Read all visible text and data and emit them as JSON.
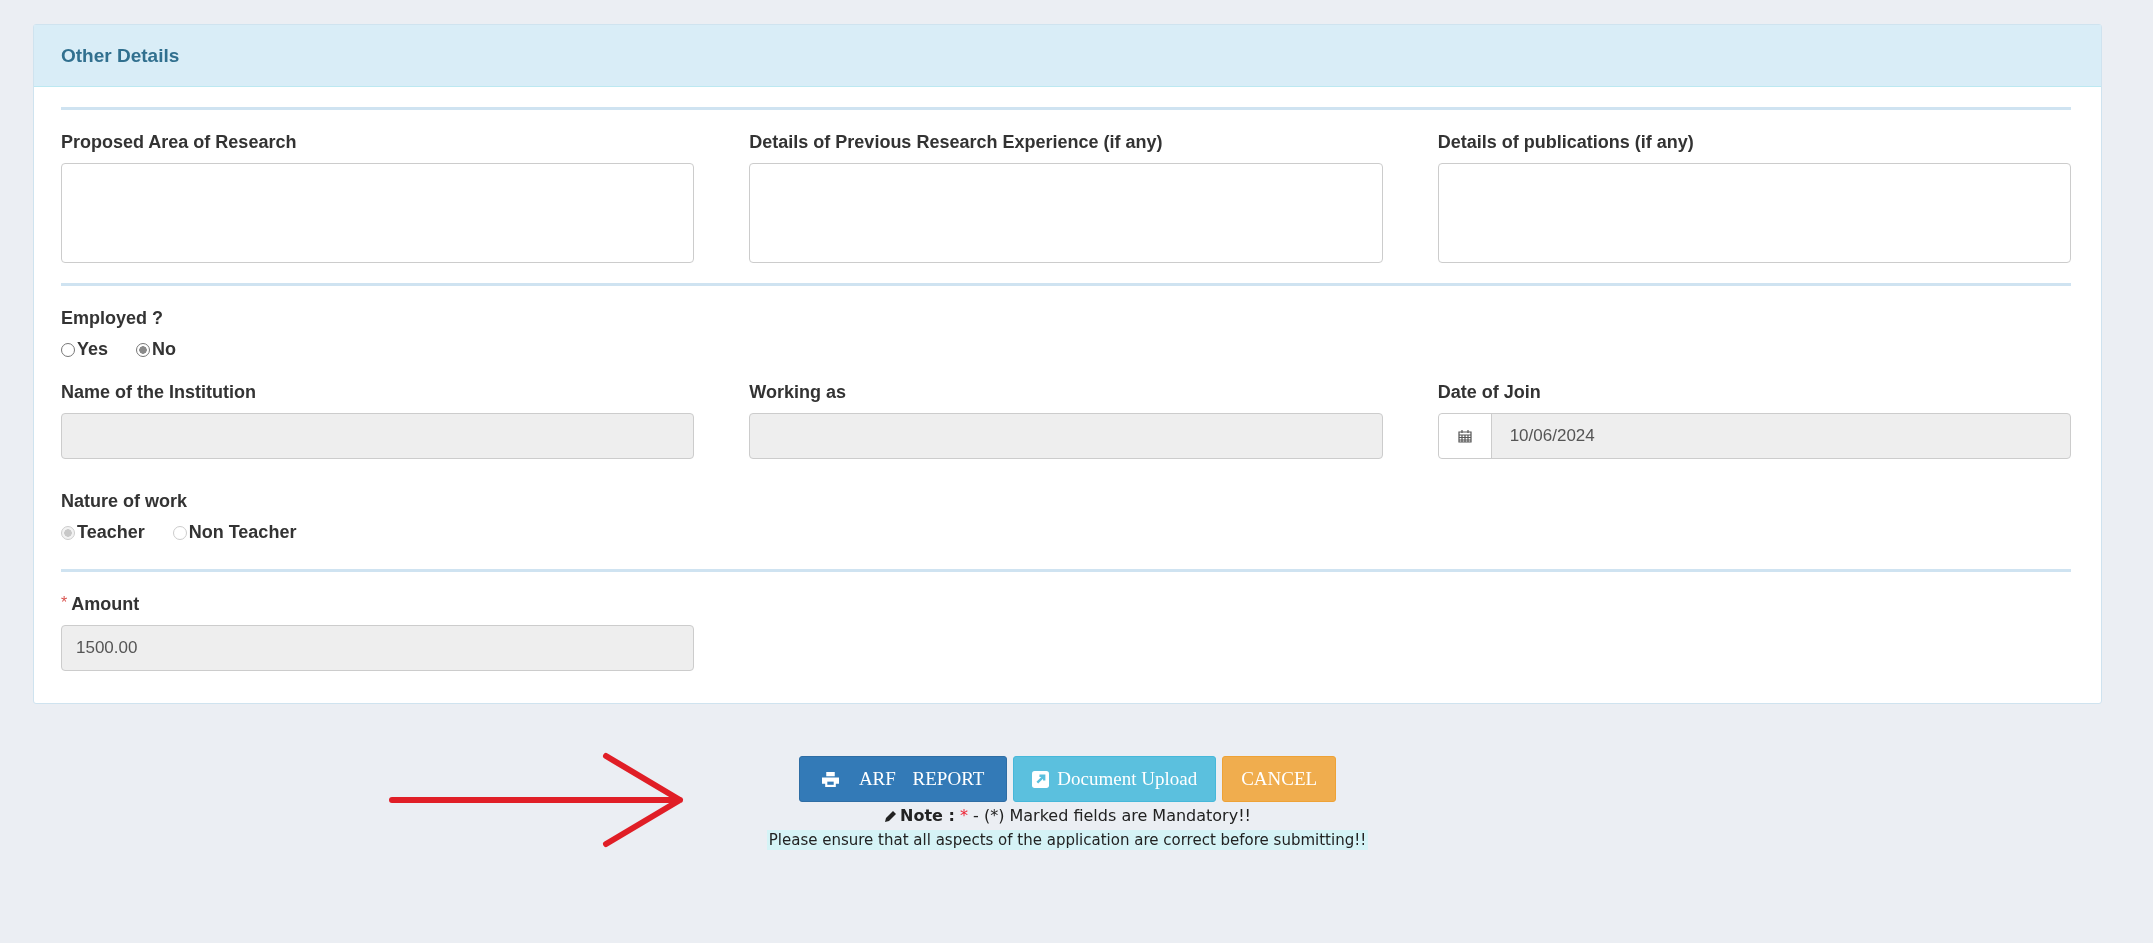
{
  "panel": {
    "title": "Other Details"
  },
  "text_areas": [
    {
      "label": "Proposed Area of Research"
    },
    {
      "label": "Details of Previous Research Experience (if any)"
    },
    {
      "label": "Details of publications (if any)"
    }
  ],
  "employed": {
    "label": "Employed ?",
    "options": [
      {
        "label": "Yes",
        "selected": false,
        "disabled": false
      },
      {
        "label": "No",
        "selected": true,
        "disabled": false
      }
    ]
  },
  "job_fields": [
    {
      "kind": "text",
      "label": "Name of the Institution",
      "disabled": true
    },
    {
      "kind": "text",
      "label": "Working as",
      "disabled": true
    },
    {
      "kind": "date",
      "label": "Date of Join",
      "value": "10/06/2024",
      "disabled": true
    }
  ],
  "nature_of_work": {
    "label": "Nature of work",
    "options": [
      {
        "label": "Teacher",
        "selected": true,
        "disabled": true
      },
      {
        "label": "Non Teacher",
        "selected": false,
        "disabled": true
      }
    ]
  },
  "amount": {
    "required_mark": "*",
    "label": "Amount",
    "value": "1500.00",
    "disabled": true
  },
  "buttons": [
    {
      "kind": "print",
      "label": "ARF REPORT"
    },
    {
      "kind": "upload",
      "label": "Document Upload"
    },
    {
      "kind": "cancel",
      "label": "CANCEL"
    }
  ],
  "note": {
    "label": "Note :",
    "required_mark": "*",
    "text": "- (*) Marked fields are Mandatory!!"
  },
  "warning": "Please ensure that all aspects of the application are correct before submitting!!"
}
